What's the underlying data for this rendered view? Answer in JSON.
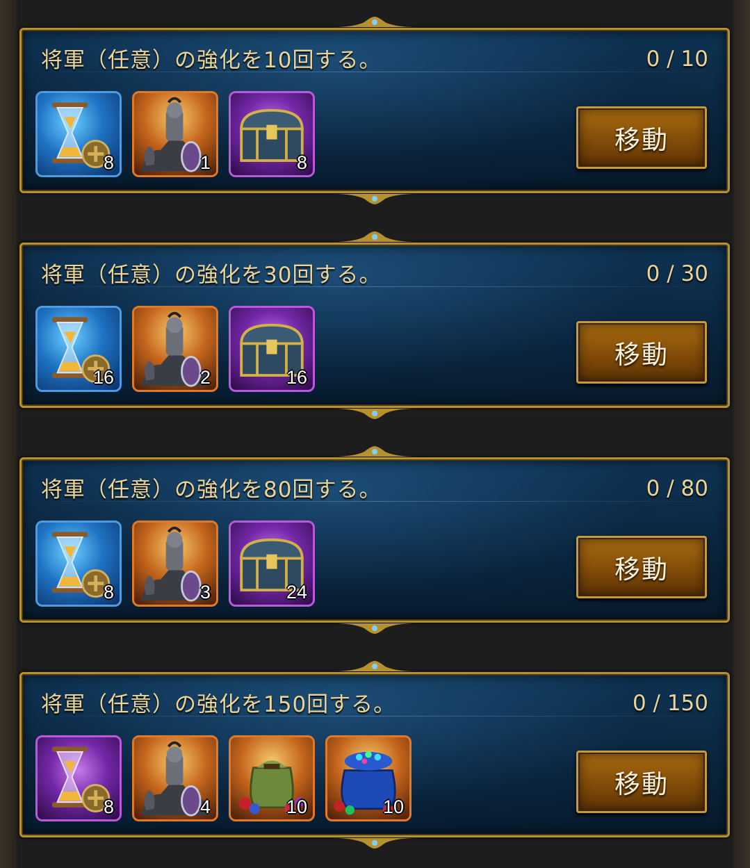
{
  "quests": [
    {
      "title": "将軍（任意）の強化を10回する。",
      "progress": "0 / 10",
      "button_label": "移動",
      "rewards": [
        {
          "icon": "hourglass-speedup-icon",
          "frame": "blue",
          "qty": "8"
        },
        {
          "icon": "knight-general-icon",
          "frame": "orange",
          "qty": "1"
        },
        {
          "icon": "treasure-chest-icon",
          "frame": "purple",
          "qty": "8"
        }
      ]
    },
    {
      "title": "将軍（任意）の強化を30回する。",
      "progress": "0 / 30",
      "button_label": "移動",
      "rewards": [
        {
          "icon": "hourglass-speedup-icon",
          "frame": "blue",
          "qty": "16"
        },
        {
          "icon": "knight-general-icon",
          "frame": "orange",
          "qty": "2"
        },
        {
          "icon": "treasure-chest-icon",
          "frame": "purple",
          "qty": "16"
        }
      ]
    },
    {
      "title": "将軍（任意）の強化を80回する。",
      "progress": "0 / 80",
      "button_label": "移動",
      "rewards": [
        {
          "icon": "hourglass-speedup-icon",
          "frame": "blue",
          "qty": "8"
        },
        {
          "icon": "knight-general-icon",
          "frame": "orange",
          "qty": "3"
        },
        {
          "icon": "treasure-chest-icon",
          "frame": "purple",
          "qty": "24"
        }
      ]
    },
    {
      "title": "将軍（任意）の強化を150回する。",
      "progress": "0 / 150",
      "button_label": "移動",
      "rewards": [
        {
          "icon": "hourglass-speedup-icon",
          "frame": "purple",
          "qty": "8"
        },
        {
          "icon": "knight-general-icon",
          "frame": "orange",
          "qty": "4"
        },
        {
          "icon": "green-gem-bag-icon",
          "frame": "orange",
          "qty": "10"
        },
        {
          "icon": "blue-gem-bag-icon",
          "frame": "orange",
          "qty": "10"
        }
      ]
    }
  ],
  "colors": {
    "gold_border": "#b8912f",
    "panel_blue": "#0b2842",
    "title_text": "#ead49a",
    "button_brown": "#8a520a"
  }
}
